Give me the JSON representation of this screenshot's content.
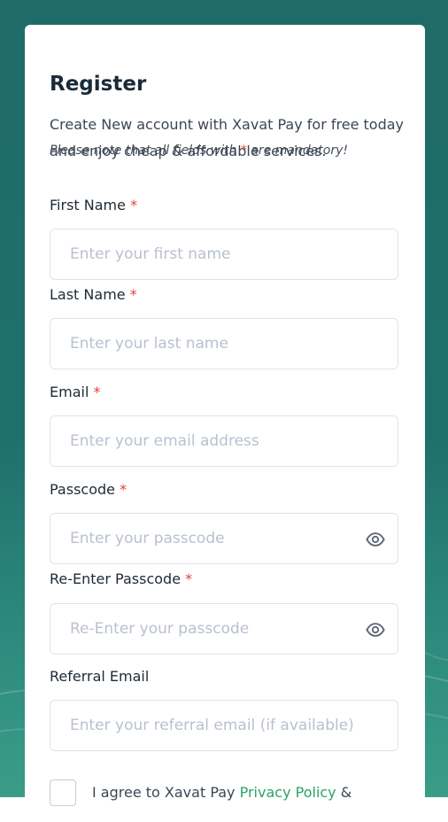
{
  "register": {
    "title": "Register",
    "subtitle": "Create New account with Xavat Pay for free today and enjoy cheap & affordable services.",
    "note_prefix": "Please note that all fields with ",
    "note_star": "*",
    "note_suffix": " are mandatory!"
  },
  "required_marker": "*",
  "fields": {
    "first_name": {
      "label": "First Name",
      "placeholder": "Enter your first name"
    },
    "last_name": {
      "label": "Last Name",
      "placeholder": "Enter your last name"
    },
    "email": {
      "label": "Email",
      "placeholder": "Enter your email address"
    },
    "passcode": {
      "label": "Passcode",
      "placeholder": "Enter your passcode"
    },
    "reenter_passcode": {
      "label": "Re-Enter Passcode",
      "placeholder": "Re-Enter your passcode"
    },
    "referral_email": {
      "label": "Referral Email",
      "placeholder": "Enter your referral email (if available)"
    }
  },
  "agreement": {
    "prefix": "I agree to Xavat Pay ",
    "link": "Privacy Policy",
    "suffix": " &"
  },
  "colors": {
    "background": "#1f6b67",
    "required": "#e0403a",
    "link": "#2aa36b"
  }
}
